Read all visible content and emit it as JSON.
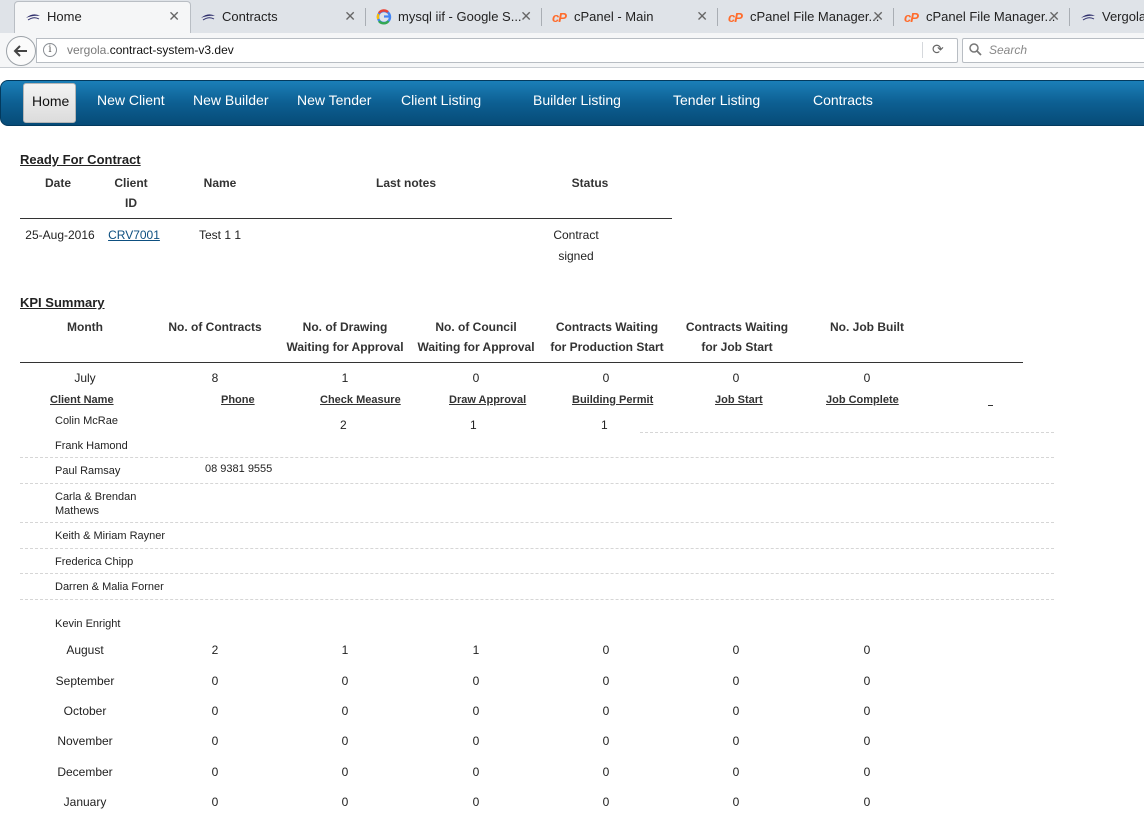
{
  "browser": {
    "tabs": [
      {
        "title": "Home",
        "icon": "vergola-icon",
        "active": true
      },
      {
        "title": "Contracts",
        "icon": "vergola-icon"
      },
      {
        "title": "mysql iif - Google S...",
        "icon": "google-icon"
      },
      {
        "title": "cPanel - Main",
        "icon": "cpanel-icon"
      },
      {
        "title": "cPanel File Manager...",
        "icon": "cpanel-icon"
      },
      {
        "title": "cPanel File Manager...",
        "icon": "cpanel-icon"
      },
      {
        "title": "Vergola",
        "icon": "vergola-icon"
      }
    ],
    "url_prefix": "vergola.",
    "url_domain": "contract-system-v3.dev",
    "search_placeholder": "Search"
  },
  "nav": {
    "items": [
      "Home",
      "New Client",
      "New Builder",
      "New Tender",
      "Client Listing",
      "Builder Listing",
      "Tender Listing",
      "Contracts"
    ],
    "active": "Home"
  },
  "ready": {
    "title": "Ready For Contract",
    "headers": {
      "date": "Date",
      "client_id_1": "Client",
      "client_id_2": "ID",
      "name": "Name",
      "last_notes": "Last notes",
      "status": "Status"
    },
    "rows": [
      {
        "date": "25-Aug-2016",
        "client_id": "CRV7001",
        "name": "Test 1 1",
        "last_notes": "",
        "status_1": "Contract",
        "status_2": "signed"
      }
    ]
  },
  "kpi": {
    "title": "KPI Summary",
    "headers": [
      [
        "Month",
        ""
      ],
      [
        "No. of Contracts",
        ""
      ],
      [
        "No. of Drawing",
        "Waiting for Approval"
      ],
      [
        "No. of Council",
        "Waiting for Approval"
      ],
      [
        "Contracts Waiting",
        "for Production Start"
      ],
      [
        "Contracts Waiting",
        "for Job Start"
      ],
      [
        "No. Job Built",
        ""
      ]
    ],
    "july": {
      "month": "July",
      "values": [
        "8",
        "1",
        "0",
        "0",
        "0",
        "0"
      ]
    },
    "detail_headers": [
      "Client Name",
      "Phone",
      "Check Measure",
      "Draw Approval",
      "Building Permit",
      "Job Start",
      "Job Complete"
    ],
    "detail_rows": [
      {
        "client": "Colin McRae",
        "phone": "",
        "check_measure": "2",
        "draw_approval": "1",
        "building_permit": "1"
      },
      {
        "client": "Frank Hamond",
        "phone": ""
      },
      {
        "client": "Paul Ramsay",
        "phone": "08 9381 9555"
      },
      {
        "client": "Carla & Brendan Mathews",
        "phone": ""
      },
      {
        "client": "Keith & Miriam Rayner",
        "phone": ""
      },
      {
        "client": "Frederica Chipp",
        "phone": ""
      },
      {
        "client": "Darren & Malia Forner",
        "phone": ""
      },
      {
        "client": "Kevin Enright",
        "phone": ""
      }
    ],
    "months": [
      {
        "month": "August",
        "values": [
          "2",
          "1",
          "1",
          "0",
          "0",
          "0"
        ]
      },
      {
        "month": "September",
        "values": [
          "0",
          "0",
          "0",
          "0",
          "0",
          "0"
        ]
      },
      {
        "month": "October",
        "values": [
          "0",
          "0",
          "0",
          "0",
          "0",
          "0"
        ]
      },
      {
        "month": "November",
        "values": [
          "0",
          "0",
          "0",
          "0",
          "0",
          "0"
        ]
      },
      {
        "month": "December",
        "values": [
          "0",
          "0",
          "0",
          "0",
          "0",
          "0"
        ]
      },
      {
        "month": "January",
        "values": [
          "0",
          "0",
          "0",
          "0",
          "0",
          "0"
        ]
      }
    ]
  }
}
